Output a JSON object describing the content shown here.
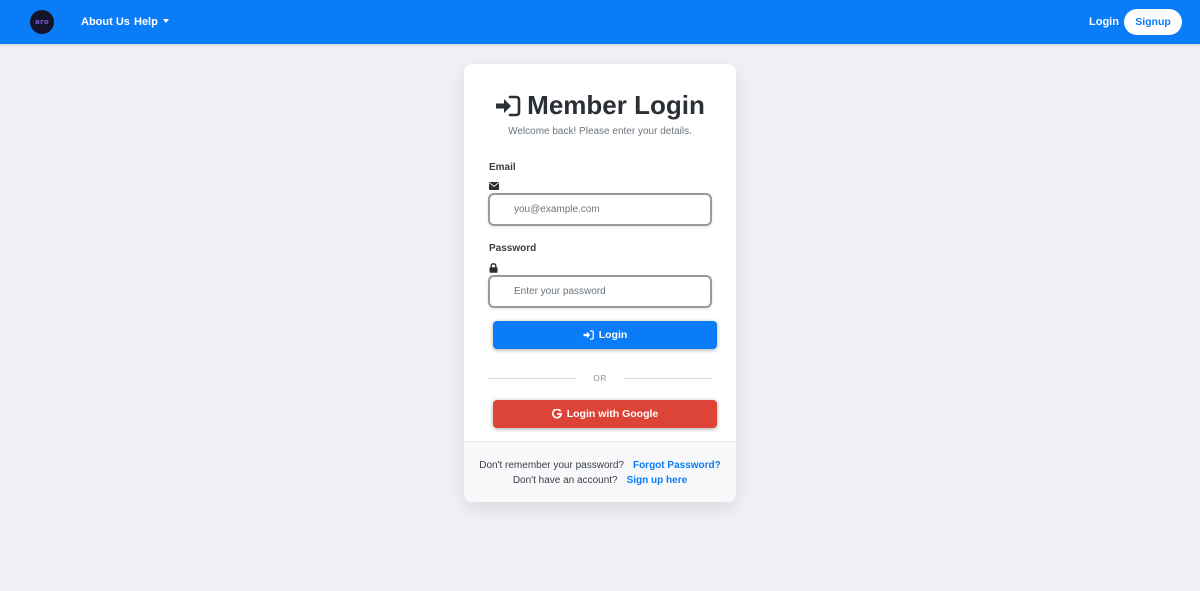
{
  "navbar": {
    "logo_text": "aro",
    "about_label": "About Us",
    "help_label": "Help",
    "login_label": "Login",
    "signup_label": "Signup",
    "bg_color": "#0a7cf8"
  },
  "card": {
    "title": "Member Login",
    "subtitle": "Welcome back! Please enter your details.",
    "email_label": "Email",
    "email_placeholder": "you@example.com",
    "email_icon": "envelope-icon",
    "password_label": "Password",
    "password_placeholder": "Enter your password",
    "password_icon": "lock-icon",
    "login_button": "Login",
    "divider_text": "OR",
    "google_button": "Login with Google",
    "google_color": "#dc4437"
  },
  "footer": {
    "forgot_prompt": "Don't remember your password?",
    "forgot_link": "Forgot Password?",
    "signup_prompt": "Don't have an account?",
    "signup_link": "Sign up here"
  }
}
